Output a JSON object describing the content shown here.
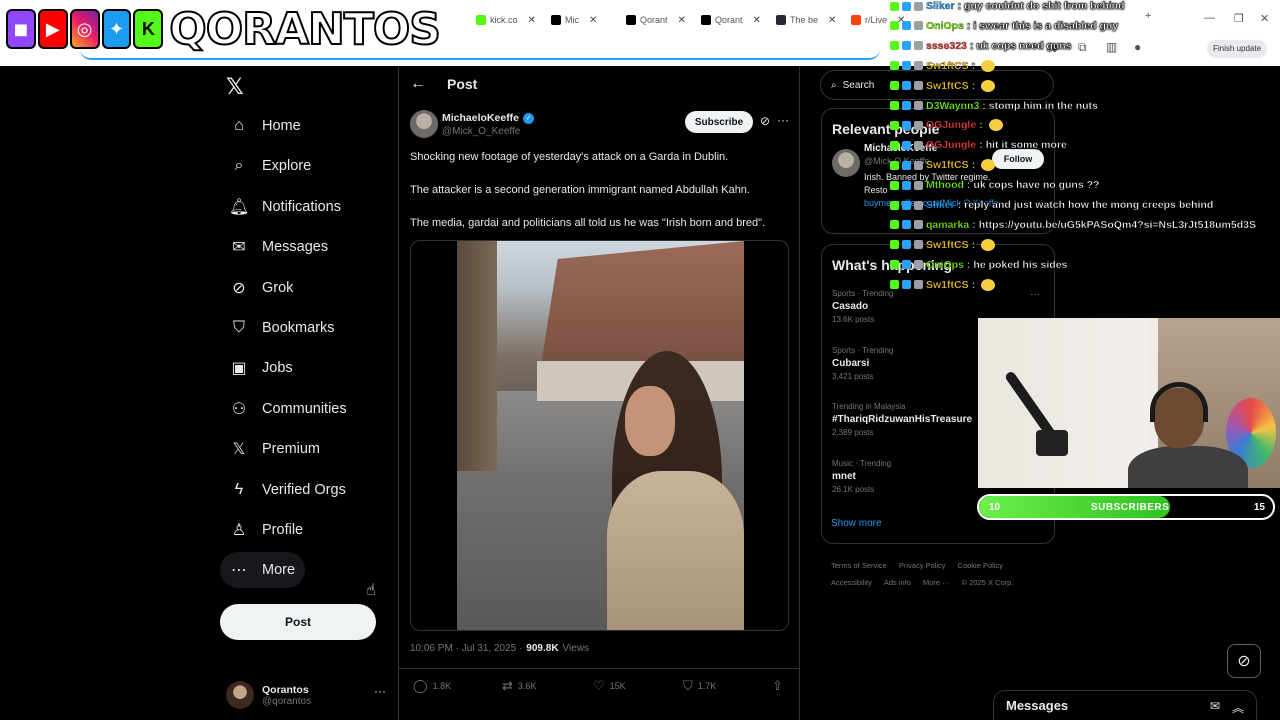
{
  "browser": {
    "tabs": [
      {
        "label": "kick.co",
        "color": "#53fc18"
      },
      {
        "label": "Mic",
        "color": "#000000"
      },
      {
        "label": "Qorant",
        "color": "#000000"
      },
      {
        "label": "Qorant",
        "color": "#000000"
      },
      {
        "label": "The be",
        "color": "#24292f"
      },
      {
        "label": "r/Live",
        "color": "#ff4500"
      }
    ],
    "finish_update": "Finish update"
  },
  "stream_overlay": {
    "name": "QORANTOS",
    "icons": [
      "twitch-icon",
      "youtube-icon",
      "instagram-icon",
      "twitter-icon",
      "kick-icon"
    ]
  },
  "nav": {
    "items": [
      {
        "label": "Home",
        "icon": "⌂",
        "name": "home"
      },
      {
        "label": "Explore",
        "icon": "⌕",
        "name": "explore"
      },
      {
        "label": "Notifications",
        "icon": "🔔︎",
        "name": "notifications"
      },
      {
        "label": "Messages",
        "icon": "✉",
        "name": "messages"
      },
      {
        "label": "Grok",
        "icon": "⊘",
        "name": "grok"
      },
      {
        "label": "Bookmarks",
        "icon": "⛉",
        "name": "bookmarks"
      },
      {
        "label": "Jobs",
        "icon": "▣",
        "name": "jobs"
      },
      {
        "label": "Communities",
        "icon": "⚇",
        "name": "communities"
      },
      {
        "label": "Premium",
        "icon": "𝕏",
        "name": "premium"
      },
      {
        "label": "Verified Orgs",
        "icon": "ϟ",
        "name": "verified-orgs"
      },
      {
        "label": "Profile",
        "icon": "♙",
        "name": "profile"
      },
      {
        "label": "More",
        "icon": "⋯",
        "name": "more"
      }
    ],
    "post_button": "Post",
    "account": {
      "name": "Qorantos",
      "handle": "@qorantos"
    }
  },
  "post": {
    "header": "Post",
    "author": {
      "name": "MichaeloKeeffe",
      "handle": "@Mick_O_Keeffe"
    },
    "subscribe": "Subscribe",
    "paragraphs": [
      "Shocking new footage of yesterday's attack on a Garda in Dublin.",
      "The attacker is a second generation immigrant named Abdullah Kahn.",
      "The media, gardai and politicians all told us he was \"Irish born and bred\"."
    ],
    "timestamp": "10:06 PM · Jul 31, 2025 ·",
    "views_count": "909.8K",
    "views_label": "Views",
    "stats": {
      "replies": "1.8K",
      "reposts": "3.6K",
      "likes": "15K",
      "bookmarks": "1.7K"
    }
  },
  "right": {
    "search_placeholder": "Search",
    "relevant_title": "Relevant people",
    "relevant_person": {
      "name": "MichaeloKeeffe",
      "handle": "@Mick O Keeffe",
      "bio_line1": "Irish. Banned by Twitter regime.",
      "bio_line2": "Resto",
      "link": "buymeacoffee.com/Mick O Keeffe",
      "follow": "Follow"
    },
    "happening_title": "What's happening",
    "trends": [
      {
        "meta": "Sports · Trending",
        "name": "Casado",
        "count": "13.6K posts"
      },
      {
        "meta": "Sports · Trending",
        "name": "Cubarsi",
        "count": "3,421 posts"
      },
      {
        "meta": "Trending in Malaysia",
        "name": "#ThariqRidzuwanHisTreasure",
        "count": "2,389 posts"
      },
      {
        "meta": "Music · Trending",
        "name": "mnet",
        "count": "26.1K posts"
      }
    ],
    "show_more": "Show more",
    "footer": [
      "Terms of Service",
      "Privacy Policy",
      "Cookie Policy",
      "Accessibility",
      "Ads info",
      "More ···",
      "© 2025 X Corp."
    ]
  },
  "chat": [
    {
      "user": "Sliker",
      "color": "#2aa3ff",
      "msg": "guy couldnt do shit from behind"
    },
    {
      "user": "OniOps",
      "color": "#7cfc00",
      "msg": "i swear this is a disabled guy"
    },
    {
      "user": "ssse323",
      "color": "#ff3b3b",
      "msg": "uk cops need guns"
    },
    {
      "user": "Sw1ftCS",
      "color": "#ffd21e",
      "msg": ""
    },
    {
      "user": "Sw1ftCS",
      "color": "#ffd21e",
      "msg": ""
    },
    {
      "user": "D3Waynn3",
      "color": "#7cfc00",
      "msg": "stomp him in the nuts"
    },
    {
      "user": "OGJungle",
      "color": "#ff3b3b",
      "msg": ""
    },
    {
      "user": "OGJungle",
      "color": "#ff3b3b",
      "msg": "hit it some more"
    },
    {
      "user": "Sw1ftCS",
      "color": "#ffd21e",
      "msg": ""
    },
    {
      "user": "Mthood",
      "color": "#7cfc00",
      "msg": "uk cops have no guns ??"
    },
    {
      "user": "Sliker",
      "color": "#2aa3ff",
      "msg": "reply and just watch how the mong creeps behind"
    },
    {
      "user": "qamarka",
      "color": "#7cfc00",
      "msg": "https://youtu.be/uG5kPASoQm4?si=NsL3rJt518um5d3S"
    },
    {
      "user": "Sw1ftCS",
      "color": "#ffd21e",
      "msg": ""
    },
    {
      "user": "OniOps",
      "color": "#7cfc00",
      "msg": "he poked his sides"
    },
    {
      "user": "Sw1ftCS",
      "color": "#ffd21e",
      "msg": ""
    }
  ],
  "subs": {
    "left": "10",
    "label": "SUBSCRIBERS",
    "right": "15",
    "progress": 0.65
  },
  "messages_drawer": "Messages"
}
